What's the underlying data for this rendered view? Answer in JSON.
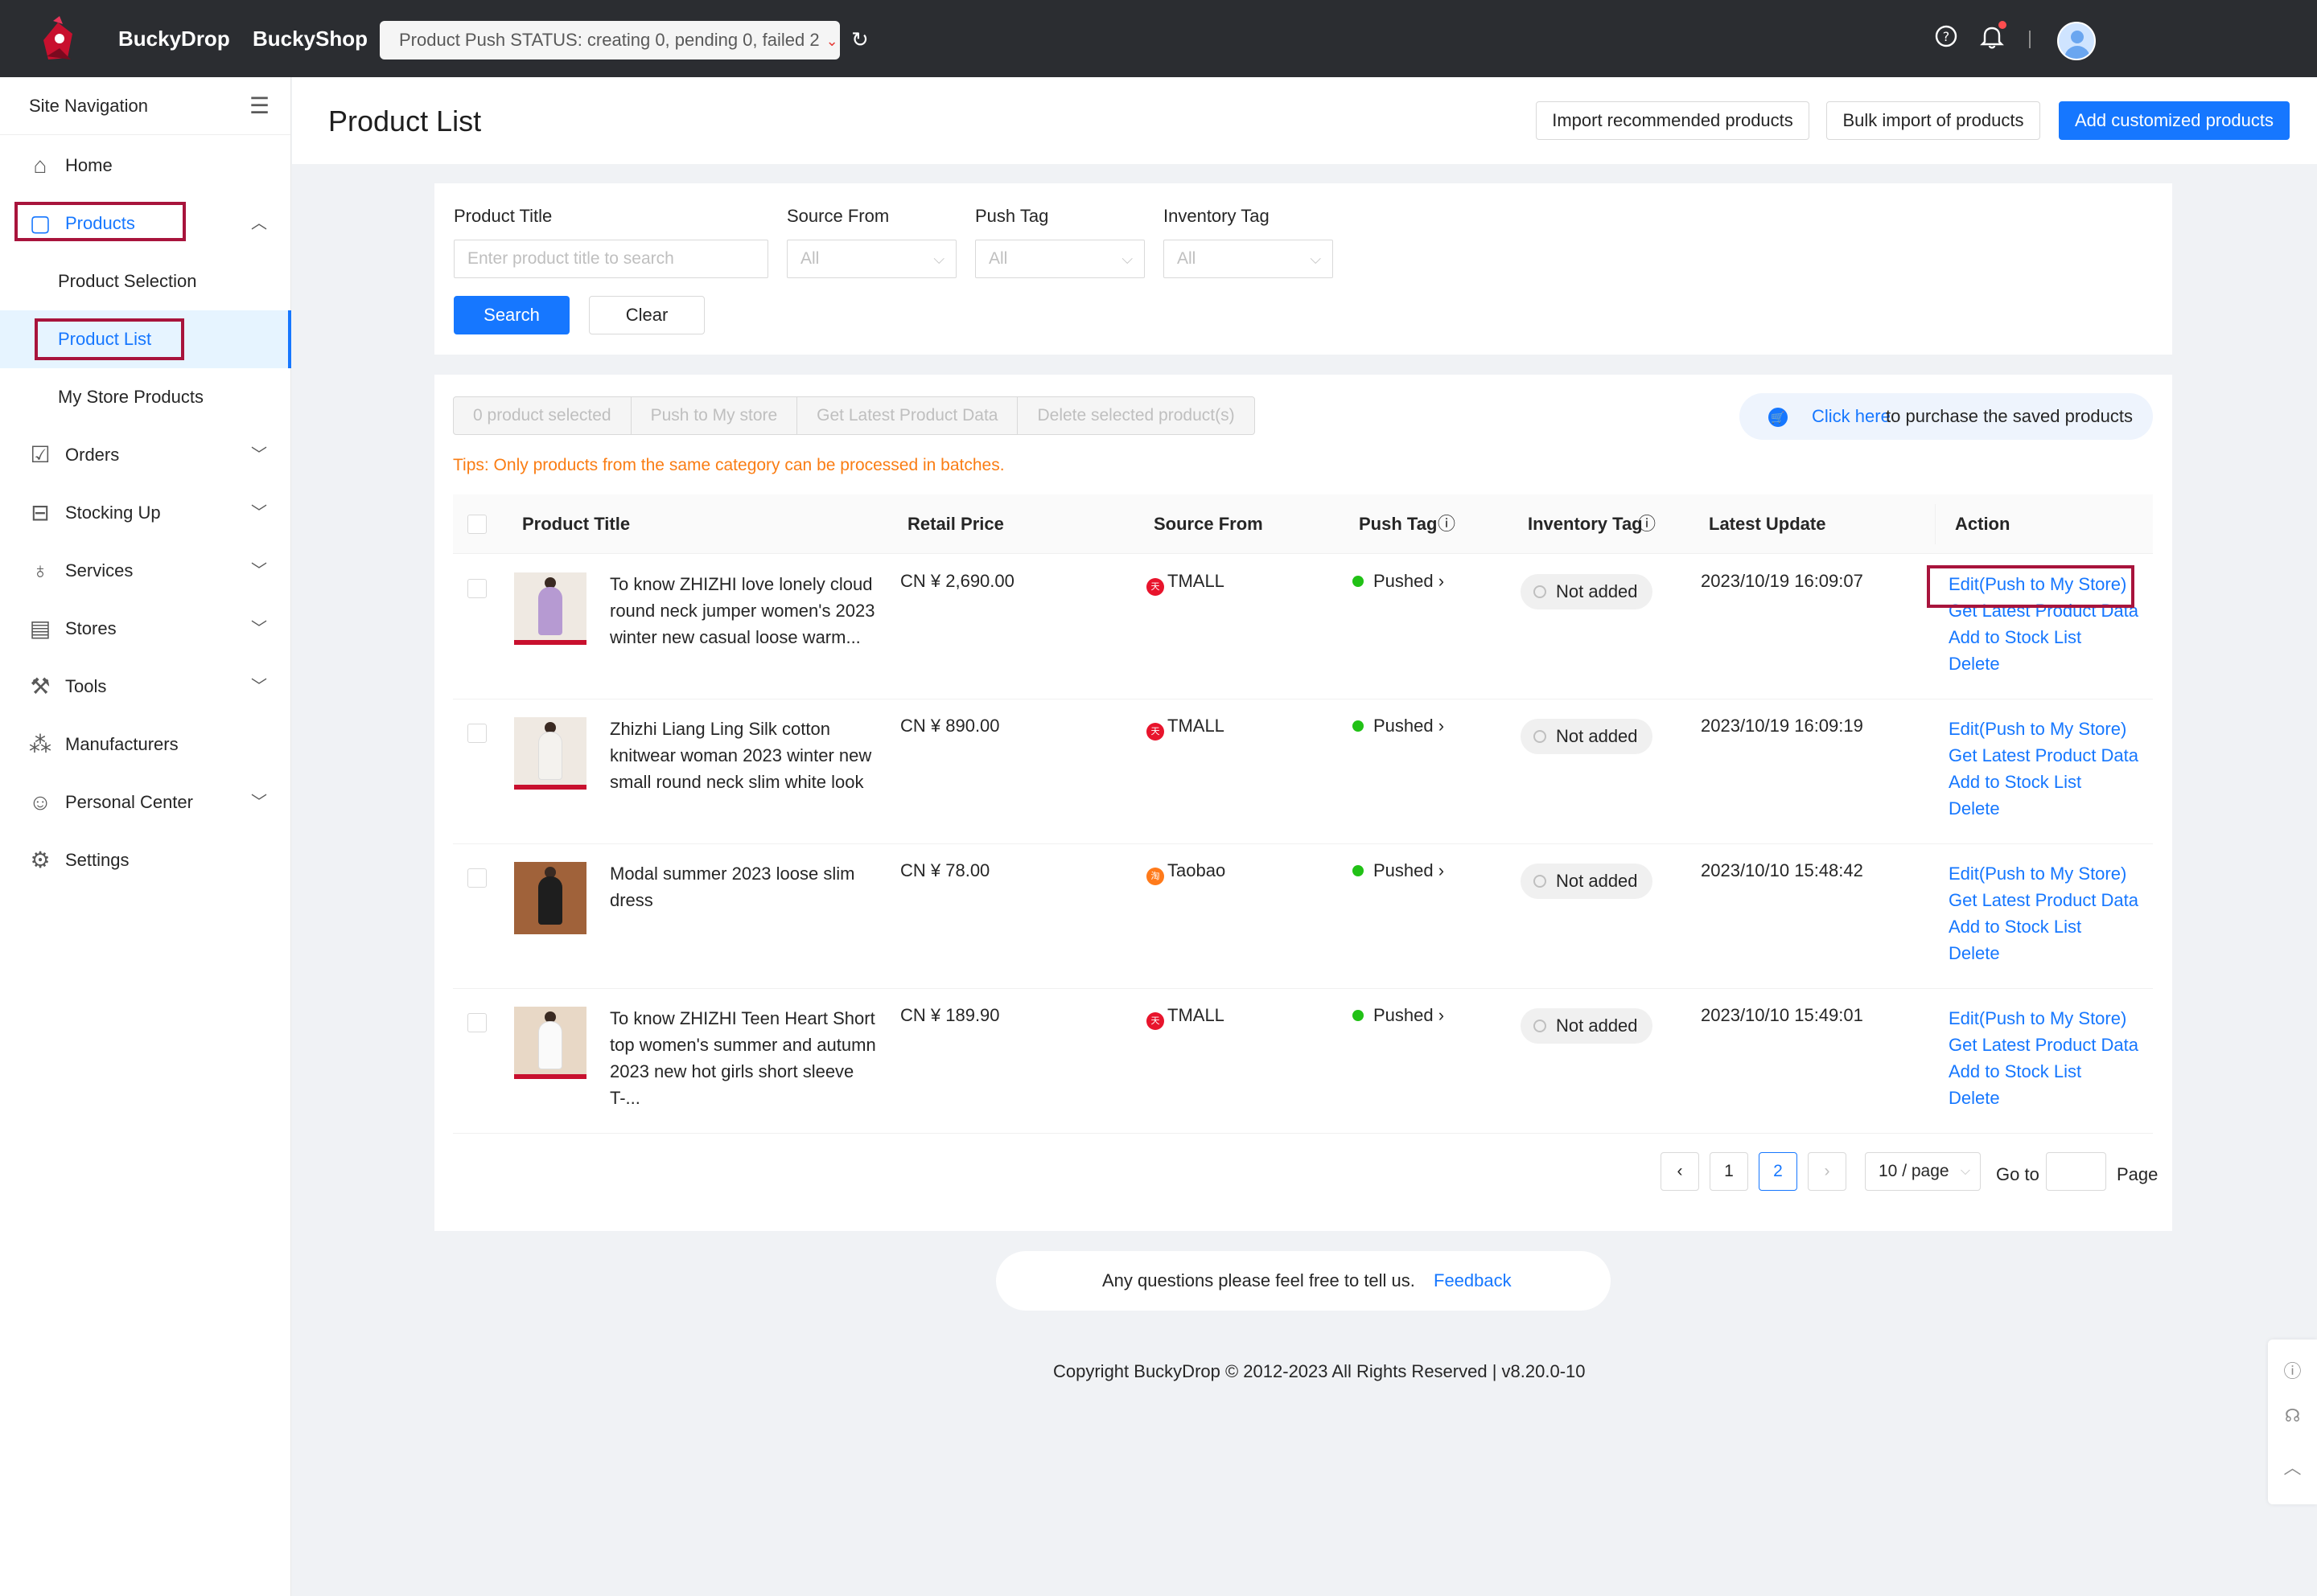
{
  "topbar": {
    "brand1": "BuckyDrop",
    "brand2": "BuckyShop",
    "status": "Product Push STATUS: creating 0, pending 0, failed 2"
  },
  "sidebar": {
    "header": "Site Navigation",
    "items": [
      {
        "label": "Home",
        "icon": "home-icon"
      },
      {
        "label": "Products",
        "icon": "shopping-bag-icon"
      },
      {
        "label": "Orders",
        "icon": "orders-icon"
      },
      {
        "label": "Stocking Up",
        "icon": "inbox-icon"
      },
      {
        "label": "Services",
        "icon": "bell-service-icon"
      },
      {
        "label": "Stores",
        "icon": "store-icon"
      },
      {
        "label": "Tools",
        "icon": "wrench-icon"
      },
      {
        "label": "Manufacturers",
        "icon": "network-icon"
      },
      {
        "label": "Personal Center",
        "icon": "user-icon"
      },
      {
        "label": "Settings",
        "icon": "gear-icon"
      }
    ],
    "sub_items": [
      "Product Selection",
      "Product List",
      "My Store Products"
    ]
  },
  "header": {
    "title": "Product List",
    "btn_import_recommended": "Import recommended products",
    "btn_bulk_import": "Bulk import of products",
    "btn_add_customized": "Add customized products"
  },
  "filters": {
    "title_label": "Product Title",
    "title_placeholder": "Enter product title to search",
    "source_label": "Source From",
    "source_value": "All",
    "push_label": "Push Tag",
    "push_value": "All",
    "inventory_label": "Inventory Tag",
    "inventory_value": "All",
    "search_btn": "Search",
    "clear_btn": "Clear"
  },
  "batch": {
    "selected": "0 product selected",
    "push": "Push to My store",
    "latest": "Get Latest Product Data",
    "delete": "Delete selected product(s)",
    "purchase_link": "Click here",
    "purchase_text": "to purchase the saved products",
    "tips": "Tips:  Only products from the same category can be processed in batches."
  },
  "table": {
    "columns": [
      "Product Title",
      "Retail Price",
      "Source From",
      "Push Tag",
      "Inventory Tag",
      "Latest Update",
      "Action"
    ],
    "rows": [
      {
        "title": "To know ZHIZHI love lonely cloud round neck jumper women's 2023 winter new casual loose warm...",
        "price": "CN ¥ 2,690.00",
        "source": "TMALL",
        "push": "Pushed",
        "inventory": "Not added",
        "updated": "2023/10/19 16:09:07"
      },
      {
        "title": "Zhizhi Liang Ling Silk cotton knitwear woman 2023 winter new small round neck slim white look",
        "price": "CN ¥ 890.00",
        "source": "TMALL",
        "push": "Pushed",
        "inventory": "Not added",
        "updated": "2023/10/19 16:09:19"
      },
      {
        "title": "Modal summer 2023 loose slim dress",
        "price": "CN ¥ 78.00",
        "source": "Taobao",
        "push": "Pushed",
        "inventory": "Not added",
        "updated": "2023/10/10 15:48:42"
      },
      {
        "title": "To know ZHIZHI Teen Heart Short top women's summer and autumn 2023 new hot girls short sleeve T-...",
        "price": "CN ¥ 189.90",
        "source": "TMALL",
        "push": "Pushed",
        "inventory": "Not added",
        "updated": "2023/10/10 15:49:01"
      }
    ],
    "actions": [
      "Edit(Push to My Store)",
      "Get Latest Product Data",
      "Add to Stock List",
      "Delete"
    ]
  },
  "pagination": {
    "pages": [
      "1",
      "2"
    ],
    "current": "2",
    "page_size": "10 / page",
    "goto_label": "Go to",
    "page_label": "Page"
  },
  "footer": {
    "question": "Any questions please feel free to tell us.",
    "feedback": "Feedback",
    "copyright": "Copyright BuckyDrop © 2012-2023 All Rights Reserved | v8.20.0-10"
  },
  "colors": {
    "accent": "#1677ff",
    "highlight_box": "#a8143c",
    "topbar": "#2b2d31",
    "tips": "#fa7d14"
  }
}
